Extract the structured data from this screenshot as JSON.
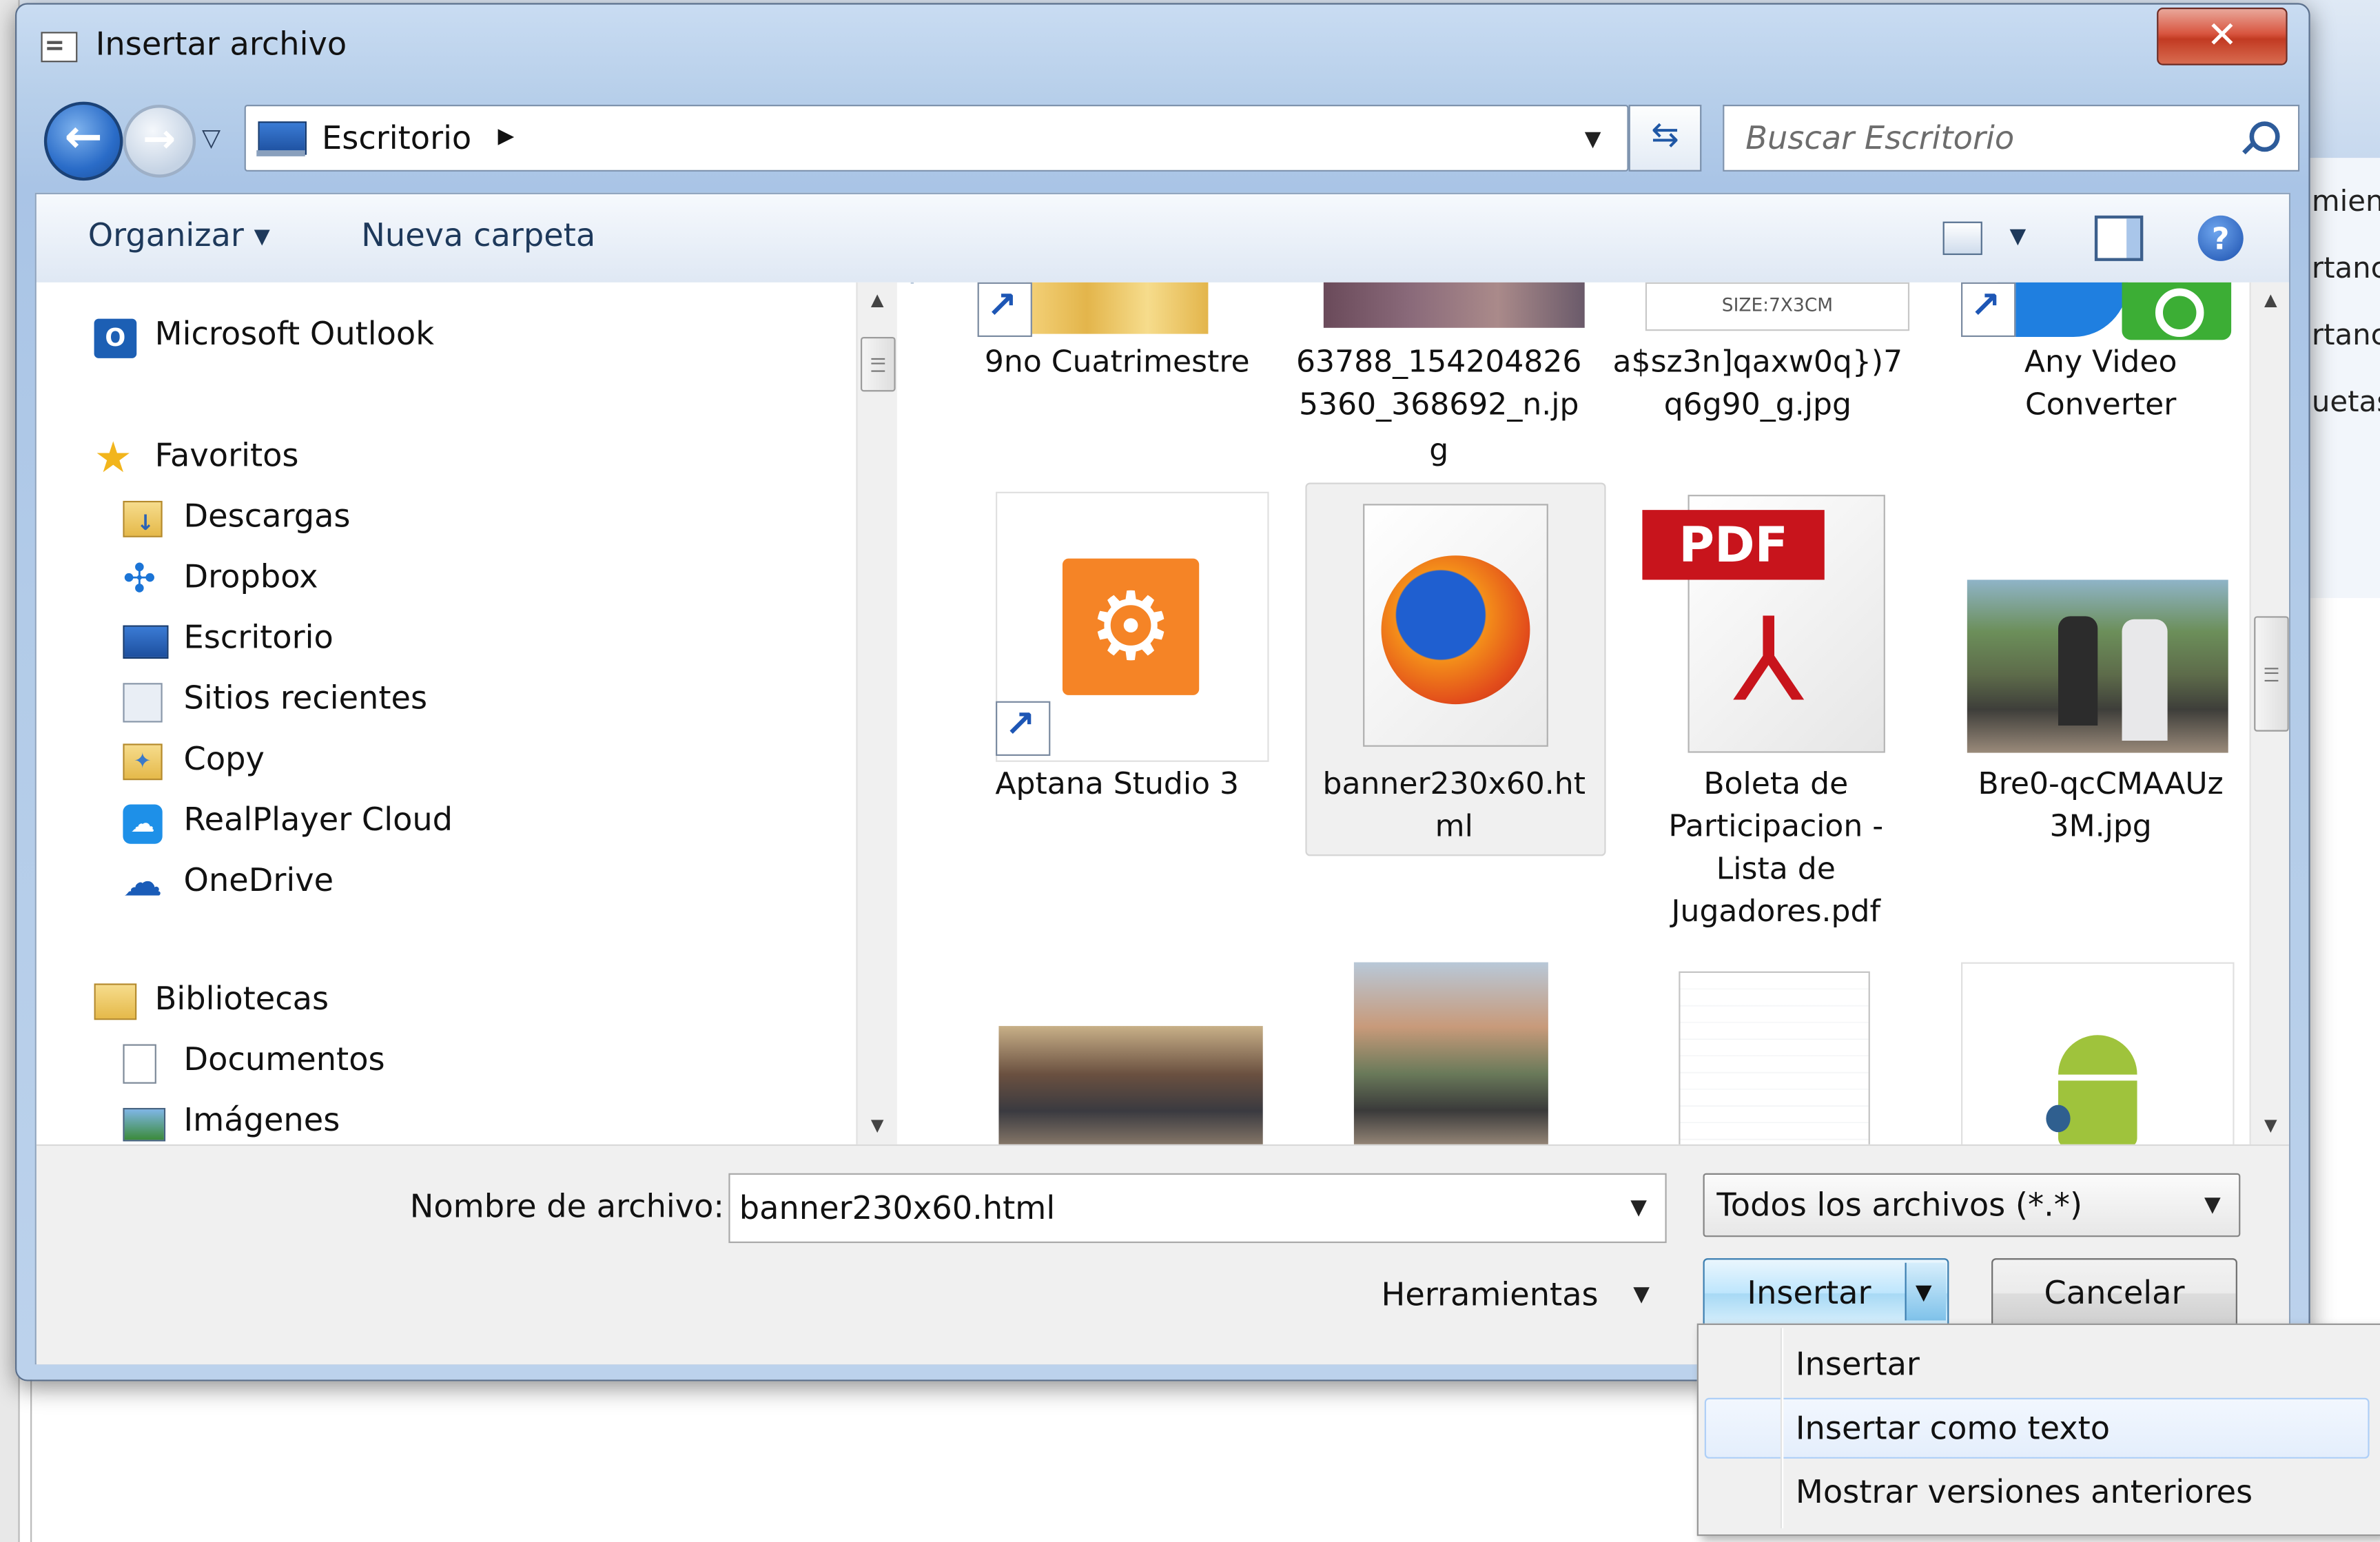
{
  "background": {
    "side_texts": [
      "mien",
      "rtanc",
      "rtanc",
      "uetas"
    ]
  },
  "dialog": {
    "title": "Insertar archivo",
    "close_label": "✕"
  },
  "nav": {
    "address": "Escritorio",
    "search_placeholder": "Buscar Escritorio"
  },
  "toolbar": {
    "organize_label": "Organizar ▾",
    "new_folder_label": "Nueva carpeta",
    "help_label": "?"
  },
  "sidebar": {
    "items": [
      {
        "label": "Microsoft Outlook",
        "icon": "outlook-icon"
      },
      {
        "label": "Favoritos",
        "icon": "star-icon"
      },
      {
        "label": "Descargas",
        "icon": "downloads-folder-icon"
      },
      {
        "label": "Dropbox",
        "icon": "dropbox-icon"
      },
      {
        "label": "Escritorio",
        "icon": "desktop-icon"
      },
      {
        "label": "Sitios recientes",
        "icon": "recent-places-icon"
      },
      {
        "label": "Copy",
        "icon": "copy-folder-icon"
      },
      {
        "label": "RealPlayer Cloud",
        "icon": "realplayer-cloud-icon"
      },
      {
        "label": "OneDrive",
        "icon": "onedrive-icon"
      },
      {
        "label": "Bibliotecas",
        "icon": "libraries-icon"
      },
      {
        "label": "Documentos",
        "icon": "documents-icon"
      },
      {
        "label": "Imágenes",
        "icon": "images-icon"
      }
    ]
  },
  "files": {
    "row1": [
      {
        "caption_lines": [
          "9no Cuatrimestre"
        ],
        "icon": "folder-shortcut-icon"
      },
      {
        "caption_lines": [
          "63788_154204826",
          "5360_368692_n.jp",
          "g"
        ],
        "icon": "photo-thumbnail"
      },
      {
        "caption_lines": [
          "a$sz3n]qaxw0q})7",
          "q6g90_g.jpg"
        ],
        "icon": "image-thumbnail",
        "thumb_text": "SIZE:7X3CM"
      },
      {
        "caption_lines": [
          "Any Video",
          "Converter"
        ],
        "icon": "app-shortcut-icon"
      }
    ],
    "row2": [
      {
        "caption_lines": [
          "Aptana Studio 3"
        ],
        "icon": "aptana-gear-icon"
      },
      {
        "caption_lines": [
          "banner230x60.ht",
          "ml"
        ],
        "icon": "firefox-html-icon"
      },
      {
        "caption_lines": [
          "Boleta de",
          "Participacion -",
          "Lista de",
          "Jugadores.pdf"
        ],
        "icon": "pdf-icon",
        "thumb_text": "PDF"
      },
      {
        "caption_lines": [
          "Bre0-qcCMAAUz",
          "3M.jpg"
        ],
        "icon": "photo-thumbnail"
      }
    ],
    "row3": [
      {
        "icon": "photo-thumbnail"
      },
      {
        "icon": "photo-thumbnail"
      },
      {
        "icon": "text-document-icon"
      },
      {
        "icon": "android-icon"
      }
    ]
  },
  "footer": {
    "filename_label": "Nombre de archivo:",
    "filename_value": "banner230x60.html",
    "filetype_value": "Todos los archivos (*.*)",
    "tools_label": "Herramientas",
    "insert_label": "Insertar",
    "cancel_label": "Cancelar"
  },
  "insert_menu": {
    "items": [
      "Insertar",
      "Insertar como texto",
      "Mostrar versiones anteriores"
    ],
    "highlighted_index": 1
  },
  "colors": {
    "close_red": "#c23a22",
    "accent_blue": "#2a6cc8",
    "selection_bg": "#f0f0f0"
  }
}
